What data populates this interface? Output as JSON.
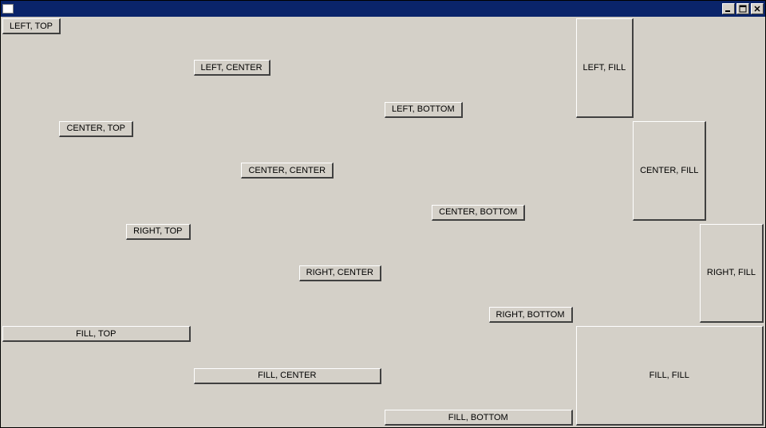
{
  "window": {
    "title": ""
  },
  "buttons": {
    "left_top": "LEFT, TOP",
    "left_center": "LEFT, CENTER",
    "left_bottom": "LEFT, BOTTOM",
    "left_fill": "LEFT, FILL",
    "center_top": "CENTER, TOP",
    "center_center": "CENTER, CENTER",
    "center_bottom": "CENTER, BOTTOM",
    "center_fill": "CENTER, FILL",
    "right_top": "RIGHT, TOP",
    "right_center": "RIGHT, CENTER",
    "right_bottom": "RIGHT, BOTTOM",
    "right_fill": "RIGHT, FILL",
    "fill_top": "FILL, TOP",
    "fill_center": "FILL, CENTER",
    "fill_bottom": "FILL, BOTTOM",
    "fill_fill": "FILL, FILL"
  }
}
